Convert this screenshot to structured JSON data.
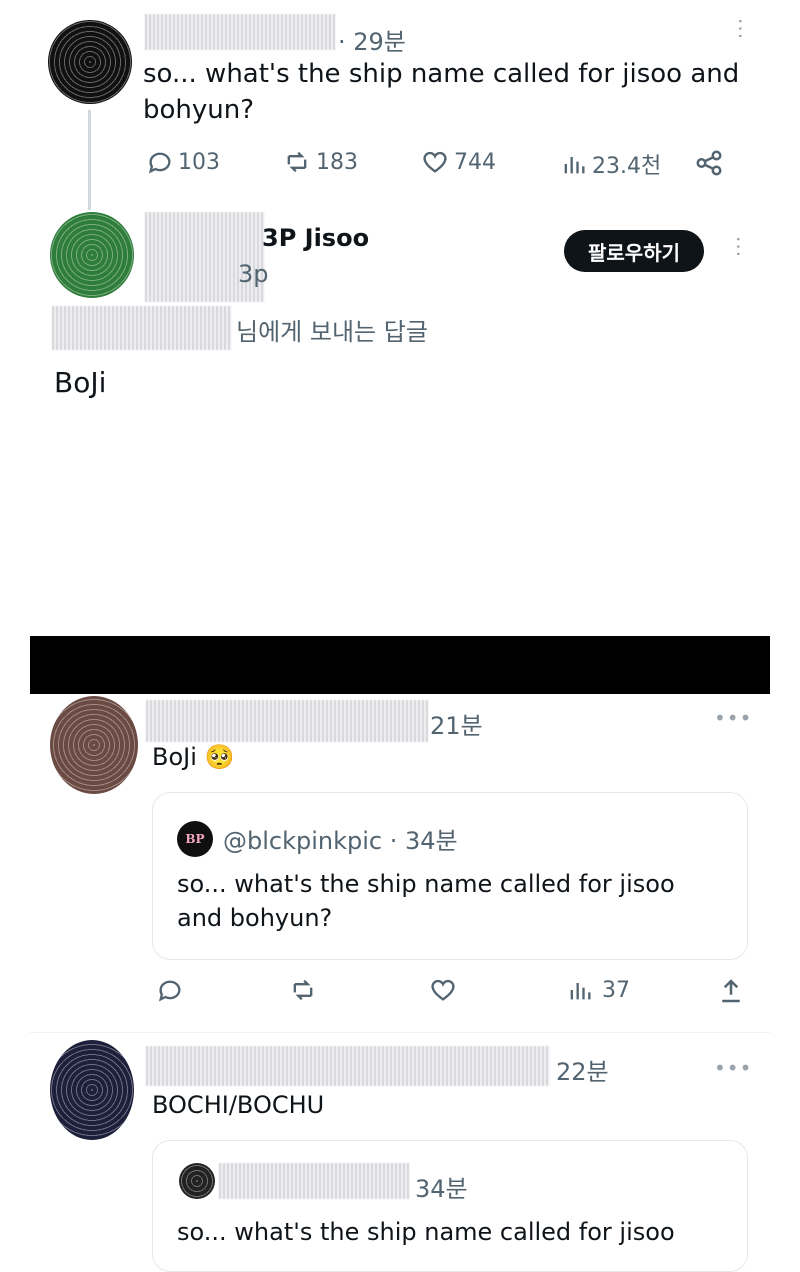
{
  "top_tweet": {
    "time": "· 29분",
    "text": "so... what's the ship name called for jisoo and bohyun?",
    "stats": {
      "replies": "103",
      "retweets": "183",
      "likes": "744",
      "views": "23.4천"
    }
  },
  "reply_header": {
    "name_partial": "3P Jisoo",
    "handle_partial": "3p",
    "follow_label": "팔로우하기",
    "reply_to": "님에게 보내는 답글",
    "text": "BoJi"
  },
  "quote_tweet_1": {
    "time": "21분",
    "text": "BoJi 🥺",
    "quoted": {
      "avatar_text": "BP",
      "handle_time": "@blckpinkpic · 34분",
      "text": "so... what's the ship name called for jisoo and bohyun?"
    },
    "views": "37"
  },
  "quote_tweet_2": {
    "time": "22분",
    "text": "BOCHI/BOCHU",
    "quoted": {
      "time": "34분",
      "text": "so... what's the ship name called for jisoo"
    }
  },
  "colors": {
    "text": "#0f1419",
    "muted": "#536471",
    "bar": "#000000",
    "button": "#0f1419"
  }
}
